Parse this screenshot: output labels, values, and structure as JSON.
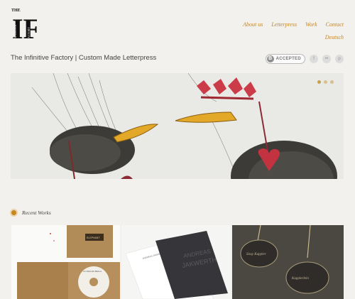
{
  "logo": {
    "top_text": "THE",
    "letters": "IF",
    "side_left": "INFINITIVE",
    "side_right": "FACTORY"
  },
  "nav": {
    "items": [
      "About us",
      "Letterpress",
      "Work",
      "Contact"
    ],
    "language": "Deutsch"
  },
  "tagline": "The Infinitive Factory | Custom Made Letterpress",
  "badges": {
    "bitcoin_symbol": "B",
    "bitcoin_text": "ACCEPTED",
    "facebook": "f",
    "flickr": "••",
    "pinterest": "p"
  },
  "hero": {
    "slides": 3,
    "active_slide": 1
  },
  "recent": {
    "label": "Recent Works"
  },
  "works": [
    {
      "stamp": "ELEPHANT",
      "cd": "LA VIDA ES BELLA"
    },
    {
      "name1": "ANDREAS",
      "name2": "JAKWERTH",
      "card_small": "ANDREAS JAKWERTH"
    },
    {
      "tag1": "Sissy Kappler",
      "tag2": "Kapplerlein"
    }
  ],
  "colors": {
    "accent": "#c8861e",
    "ink": "#444444",
    "background": "#f2f1ee"
  }
}
